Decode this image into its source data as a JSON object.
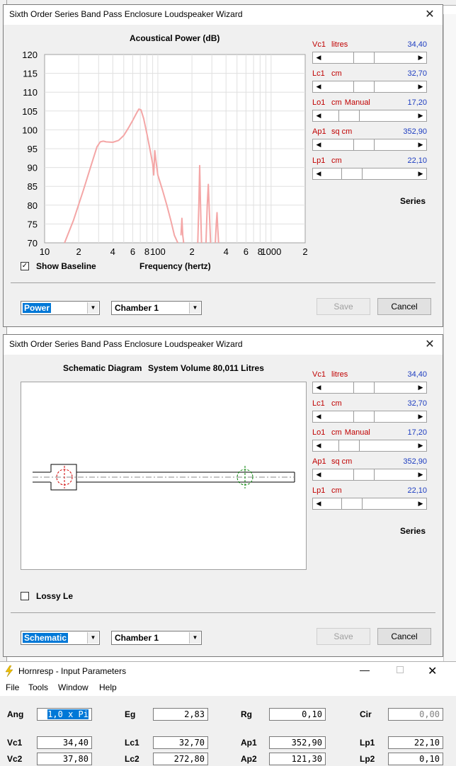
{
  "window1": {
    "title": "Sixth Order Series Band Pass Enclosure Loudspeaker Wizard",
    "close_glyph": "✕",
    "chart_title": "Acoustical Power (dB)",
    "xlabel": "Frequency (hertz)",
    "show_baseline_label": "Show Baseline",
    "show_baseline_checked": true,
    "mode_select": "Power",
    "chamber_select": "Chamber 1",
    "save_label": "Save",
    "cancel_label": "Cancel",
    "series_label": "Series"
  },
  "window2": {
    "title": "Sixth Order Series Band Pass Enclosure Loudspeaker Wizard",
    "close_glyph": "✕",
    "heading": "Schematic Diagram",
    "system_volume": "System Volume 80,011 Litres",
    "lossy_label": "Lossy Le",
    "lossy_checked": false,
    "mode_select": "Schematic",
    "chamber_select": "Chamber 1",
    "save_label": "Save",
    "cancel_label": "Cancel",
    "series_label": "Series"
  },
  "sliders": [
    {
      "name": "Vc1",
      "unit": "litres",
      "extra": "",
      "value": "34,40",
      "position": 0.42
    },
    {
      "name": "Lc1",
      "unit": "cm",
      "extra": "",
      "value": "32,70",
      "position": 0.42
    },
    {
      "name": "Lo1",
      "unit": "cm",
      "extra": "Manual",
      "value": "17,20",
      "position": 0.2
    },
    {
      "name": "Ap1",
      "unit": "sq cm",
      "extra": "",
      "value": "352,90",
      "position": 0.42
    },
    {
      "name": "Lp1",
      "unit": "cm",
      "extra": "",
      "value": "22,10",
      "position": 0.24
    }
  ],
  "chart_data": {
    "type": "line",
    "title": "Acoustical Power (dB)",
    "xlabel": "Frequency (hertz)",
    "ylabel": "",
    "xscale": "log",
    "xlim": [
      10,
      2000
    ],
    "ylim": [
      70,
      120
    ],
    "yticks": [
      70,
      75,
      80,
      85,
      90,
      95,
      100,
      105,
      110,
      115,
      120
    ],
    "xtick_labels": [
      "10",
      "2",
      "4",
      "6",
      "8",
      "100",
      "2",
      "4",
      "6",
      "8",
      "1000",
      "2"
    ],
    "grid": true,
    "series": [
      {
        "color": "#f4a6a6",
        "points": [
          [
            15,
            70
          ],
          [
            18,
            76
          ],
          [
            22,
            84
          ],
          [
            26,
            91
          ],
          [
            29,
            95.5
          ],
          [
            31,
            96.8
          ],
          [
            33,
            97
          ],
          [
            35,
            96.8
          ],
          [
            40,
            96.7
          ],
          [
            45,
            97.2
          ],
          [
            50,
            98.5
          ],
          [
            55,
            100.5
          ],
          [
            60,
            102.5
          ],
          [
            65,
            104.5
          ],
          [
            68,
            105.5
          ],
          [
            71,
            105.3
          ],
          [
            75,
            103
          ],
          [
            80,
            99
          ],
          [
            85,
            95
          ],
          [
            90,
            91
          ],
          [
            92,
            88
          ],
          [
            94,
            94.5
          ],
          [
            96,
            92
          ],
          [
            100,
            88
          ],
          [
            110,
            84
          ],
          [
            120,
            80
          ],
          [
            130,
            76
          ],
          [
            140,
            72
          ],
          [
            150,
            70
          ]
        ]
      },
      {
        "color": "#f4a6a6",
        "points": [
          [
            160,
            72
          ],
          [
            163,
            76.5
          ],
          [
            166,
            72
          ],
          [
            169,
            70
          ]
        ]
      },
      {
        "color": "#f4a6a6",
        "points": [
          [
            225,
            70
          ],
          [
            230,
            80
          ],
          [
            234,
            90.5
          ],
          [
            238,
            80
          ],
          [
            243,
            70
          ]
        ]
      },
      {
        "color": "#f4a6a6",
        "points": [
          [
            266,
            70
          ],
          [
            273,
            80
          ],
          [
            279,
            85.5
          ],
          [
            285,
            78
          ],
          [
            292,
            70
          ]
        ]
      },
      {
        "color": "#f4a6a6",
        "points": [
          [
            322,
            70
          ],
          [
            328,
            75
          ],
          [
            333,
            78
          ],
          [
            338,
            74
          ],
          [
            344,
            70
          ]
        ]
      }
    ]
  },
  "hornresp": {
    "title": "Hornresp - Input Parameters",
    "menu": [
      "File",
      "Tools",
      "Window",
      "Help"
    ],
    "row1": [
      {
        "label": "Ang",
        "value": "1,0 x Pi",
        "selected": true,
        "grey": false
      },
      {
        "label": "Eg",
        "value": "2,83",
        "selected": false,
        "grey": false
      },
      {
        "label": "Rg",
        "value": "0,10",
        "selected": false,
        "grey": false
      },
      {
        "label": "Cir",
        "value": "0,00",
        "selected": false,
        "grey": true
      }
    ],
    "row2": [
      {
        "label": "Vc1",
        "value": "34,40"
      },
      {
        "label": "Lc1",
        "value": "32,70"
      },
      {
        "label": "Ap1",
        "value": "352,90"
      },
      {
        "label": "Lp1",
        "value": "22,10"
      }
    ],
    "row3": [
      {
        "label": "Vc2",
        "value": "37,80"
      },
      {
        "label": "Lc2",
        "value": "272,80"
      },
      {
        "label": "Ap2",
        "value": "121,30"
      },
      {
        "label": "Lp2",
        "value": "0,10"
      }
    ]
  }
}
